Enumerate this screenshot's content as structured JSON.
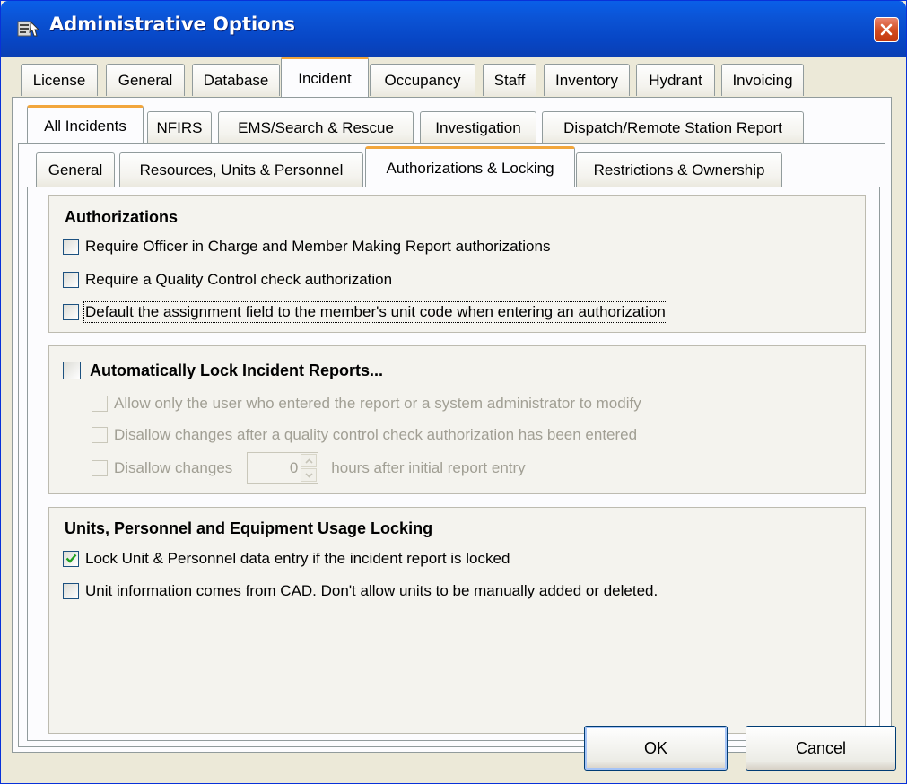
{
  "window": {
    "title": "Administrative Options",
    "icon": "admin-options-icon",
    "close_icon": "close-icon"
  },
  "tabs_level1": [
    {
      "label": "License",
      "active": false
    },
    {
      "label": "General",
      "active": false
    },
    {
      "label": "Database",
      "active": false
    },
    {
      "label": "Incident",
      "active": true
    },
    {
      "label": "Occupancy",
      "active": false
    },
    {
      "label": "Staff",
      "active": false
    },
    {
      "label": "Inventory",
      "active": false
    },
    {
      "label": "Hydrant",
      "active": false
    },
    {
      "label": "Invoicing",
      "active": false
    }
  ],
  "tabs_level2": [
    {
      "label": "All Incidents",
      "active": true
    },
    {
      "label": "NFIRS",
      "active": false
    },
    {
      "label": "EMS/Search & Rescue",
      "active": false
    },
    {
      "label": "Investigation",
      "active": false
    },
    {
      "label": "Dispatch/Remote Station Report",
      "active": false
    }
  ],
  "tabs_level3": [
    {
      "label": "General",
      "active": false
    },
    {
      "label": "Resources, Units & Personnel",
      "active": false
    },
    {
      "label": "Authorizations & Locking",
      "active": true
    },
    {
      "label": "Restrictions & Ownership",
      "active": false
    }
  ],
  "authorizations": {
    "title": "Authorizations",
    "options": [
      {
        "label": "Require Officer in Charge and Member Making Report authorizations",
        "checked": false
      },
      {
        "label": "Require a Quality Control check authorization",
        "checked": false
      },
      {
        "label": "Default the assignment field to the member's unit code when entering an authorization",
        "checked": false,
        "focused": true
      }
    ]
  },
  "locking": {
    "title": "Automatically Lock Incident Reports...",
    "checked": false,
    "options": [
      {
        "label": "Allow only the user who entered the report or a system administrator to modify",
        "checked": false,
        "enabled": false
      },
      {
        "label": "Disallow changes after a quality control check authorization has been entered",
        "checked": false,
        "enabled": false
      }
    ],
    "hours_option": {
      "label_before": "Disallow changes",
      "value": "0",
      "label_after": "hours after initial report entry",
      "checked": false,
      "enabled": false
    }
  },
  "units_locking": {
    "title": "Units, Personnel and Equipment Usage Locking",
    "options": [
      {
        "label": "Lock Unit & Personnel data entry if the incident report is locked",
        "checked": true
      },
      {
        "label": "Unit information comes from CAD. Don't allow units to be manually added or deleted.",
        "checked": false
      }
    ]
  },
  "buttons": {
    "ok": "OK",
    "cancel": "Cancel"
  },
  "colors": {
    "titlebar": "#0a5fe8",
    "dialog_bg": "#ece9d8",
    "active_tab_accent": "#f2a63c",
    "checkmark": "#21a121"
  }
}
